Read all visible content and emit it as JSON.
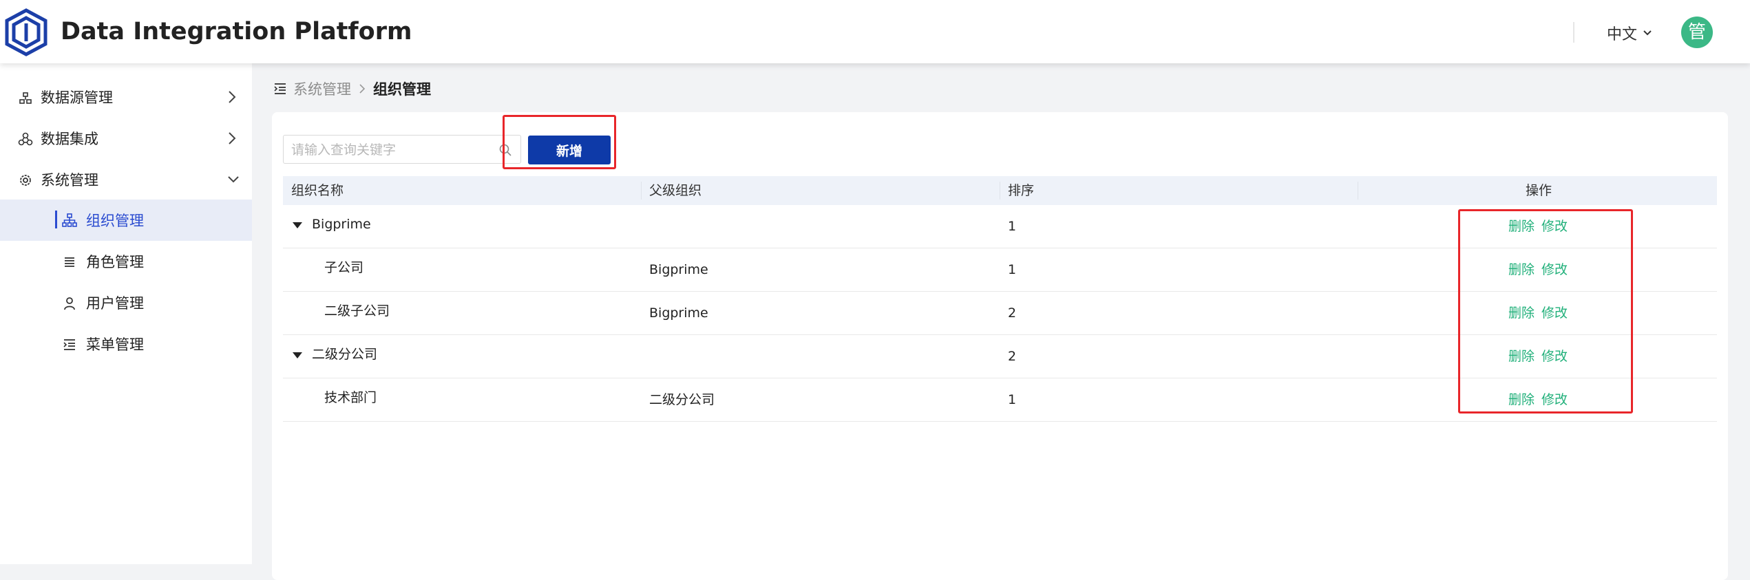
{
  "header": {
    "app_title": "Data Integration Platform",
    "language": "中文",
    "avatar_text": "管"
  },
  "sidebar": {
    "items": [
      {
        "label": "数据源管理",
        "icon": "datasource-icon",
        "expanded": false
      },
      {
        "label": "数据集成",
        "icon": "integration-icon",
        "expanded": false
      },
      {
        "label": "系统管理",
        "icon": "gear-icon",
        "expanded": true
      }
    ],
    "sub_items": [
      {
        "label": "组织管理",
        "icon": "org-tree-icon",
        "active": true
      },
      {
        "label": "角色管理",
        "icon": "list-icon",
        "active": false
      },
      {
        "label": "用户管理",
        "icon": "user-icon",
        "active": false
      },
      {
        "label": "菜单管理",
        "icon": "menu-indent-icon",
        "active": false
      }
    ]
  },
  "breadcrumb": {
    "parent": "系统管理",
    "current": "组织管理"
  },
  "toolbar": {
    "search_placeholder": "请输入查询关键字",
    "add_label": "新增"
  },
  "table": {
    "columns": [
      "组织名称",
      "父级组织",
      "排序",
      "操作"
    ],
    "rows": [
      {
        "name": "Bigprime",
        "parent": "",
        "order": "1",
        "expandable": true,
        "level": 0
      },
      {
        "name": "子公司",
        "parent": "Bigprime",
        "order": "1",
        "expandable": false,
        "level": 1
      },
      {
        "name": "二级子公司",
        "parent": "Bigprime",
        "order": "2",
        "expandable": false,
        "level": 1
      },
      {
        "name": "二级分公司",
        "parent": "",
        "order": "2",
        "expandable": true,
        "level": 0
      },
      {
        "name": "技术部门",
        "parent": "二级分公司",
        "order": "1",
        "expandable": false,
        "level": 1
      }
    ],
    "actions": {
      "delete": "删除",
      "edit": "修改"
    }
  },
  "colors": {
    "primary": "#0e3aa8",
    "action_link": "#21b07a",
    "avatar_bg": "#3bb886",
    "highlight": "#e8262a"
  }
}
